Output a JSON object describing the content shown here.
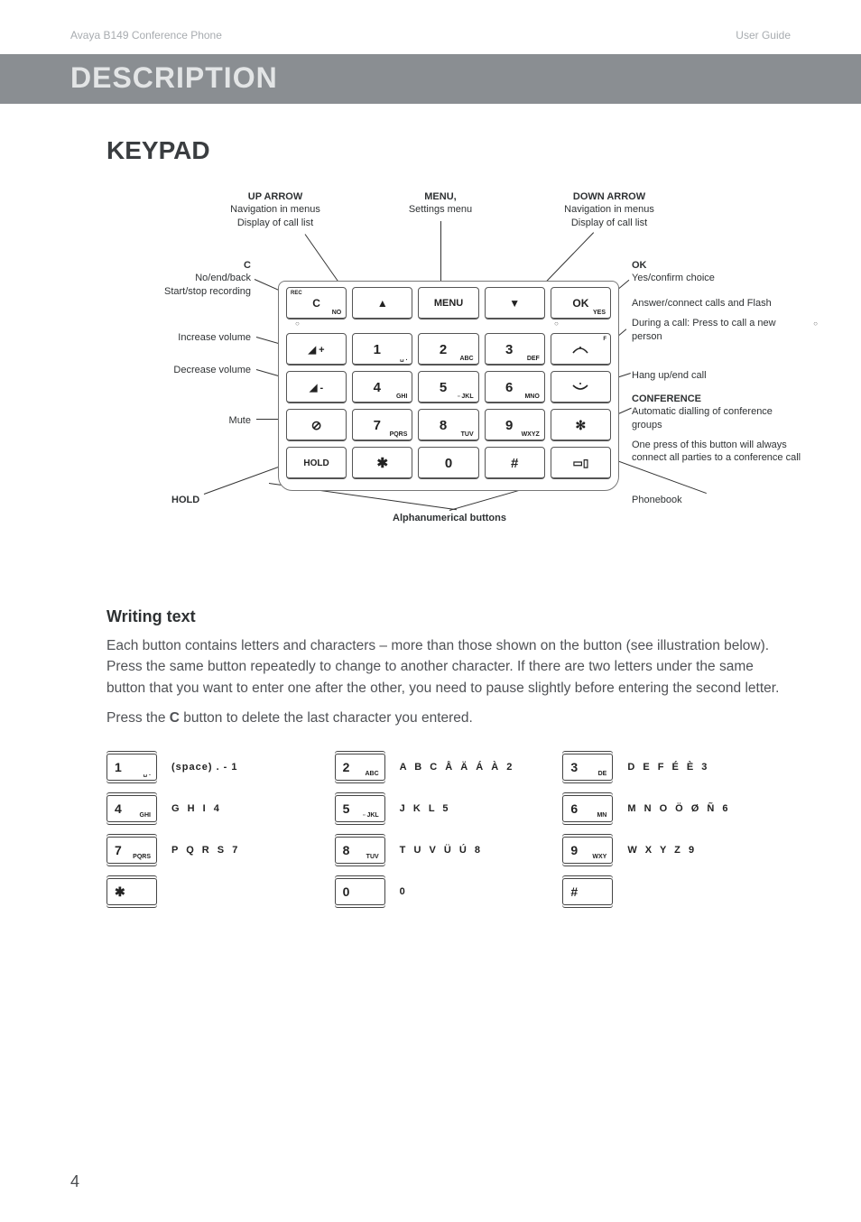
{
  "header": {
    "left": "Avaya B149 Conference Phone",
    "right": "User Guide"
  },
  "title": "DESCRIPTION",
  "section": "KEYPAD",
  "diagram": {
    "topLabels": {
      "upArrow": {
        "title": "UP ARROW",
        "l1": "Navigation in menus",
        "l2": "Display of call list"
      },
      "menu": {
        "title": "MENU,",
        "l1": "Settings menu"
      },
      "downArrow": {
        "title": "DOWN ARROW",
        "l1": "Navigation in menus",
        "l2": "Display of call list"
      }
    },
    "leftLabels": {
      "c": {
        "title": "C",
        "l1": "No/end/back",
        "l2": "Start/stop recording"
      },
      "volUp": "Increase volume",
      "volDown": "Decrease volume",
      "mute": "Mute",
      "hold": "HOLD"
    },
    "rightLabels": {
      "ok": {
        "title": "OK",
        "l1": "Yes/confirm choice"
      },
      "flash": {
        "l1": "Answer/connect calls and Flash",
        "l2": "During a call: Press to call a new person"
      },
      "hangup": "Hang up/end call",
      "conf": {
        "title": "CONFERENCE",
        "l1": "Automatic dialling of conference groups",
        "l2": "One press of this button will always connect all parties to a conference call"
      },
      "phonebook": "Phonebook"
    },
    "bottomLabel": "Alphanumerical buttons",
    "keys": {
      "c": "C",
      "menu": "MENU",
      "ok": "OK",
      "hold": "HOLD",
      "rec": "REC",
      "no": "NO",
      "yes": "YES",
      "f": "F",
      "n1": "1",
      "n2": "2",
      "n3": "3",
      "n4": "4",
      "n5": "5",
      "n6": "6",
      "n7": "7",
      "n8": "8",
      "n9": "9",
      "n0": "0",
      "s1": "␣ .",
      "s2": "ABC",
      "s3": "DEF",
      "s4": "GHI",
      "s5": "▫ JKL",
      "s6": "MNO",
      "s7": "PQRS",
      "s8": "TUV",
      "s9": "WXYZ",
      "star": "✱",
      "hash": "#"
    }
  },
  "writing": {
    "heading": "Writing text",
    "p1": "Each button contains letters and characters – more than those shown on the button (see illustration below). Press the same button repeatedly to change to another character. If there are two letters under the same button that you want to enter one after the other, you need to pause slightly before entering the second letter.",
    "p2a": "Press the ",
    "p2bold": "C",
    "p2b": " button to delete the last character you entered."
  },
  "charMap": {
    "k1": {
      "n": "1",
      "s": "␣ .",
      "t": "(space)  .  - 1"
    },
    "k2": {
      "n": "2",
      "s": "ABC",
      "t": "A B C Å Ä Á À 2"
    },
    "k3": {
      "n": "3",
      "s": "DE",
      "t": "D E F É È 3"
    },
    "k4": {
      "n": "4",
      "s": "GHI",
      "t": "G H I 4"
    },
    "k5": {
      "n": "5",
      "s": "▫ JKL",
      "t": "J K L 5"
    },
    "k6": {
      "n": "6",
      "s": "MN",
      "t": "M N O Ö Ø Ñ 6"
    },
    "k7": {
      "n": "7",
      "s": "PQRS",
      "t": "P Q R S 7"
    },
    "k8": {
      "n": "8",
      "s": "TUV",
      "t": "T U V Ü Ú 8"
    },
    "k9": {
      "n": "9",
      "s": "WXY",
      "t": "W X Y Z 9"
    },
    "kstar": {
      "n": "✱",
      "s": "",
      "t": ""
    },
    "k0": {
      "n": "0",
      "s": "",
      "t": "0"
    },
    "khash": {
      "n": "#",
      "s": "",
      "t": ""
    }
  },
  "pageNumber": "4"
}
